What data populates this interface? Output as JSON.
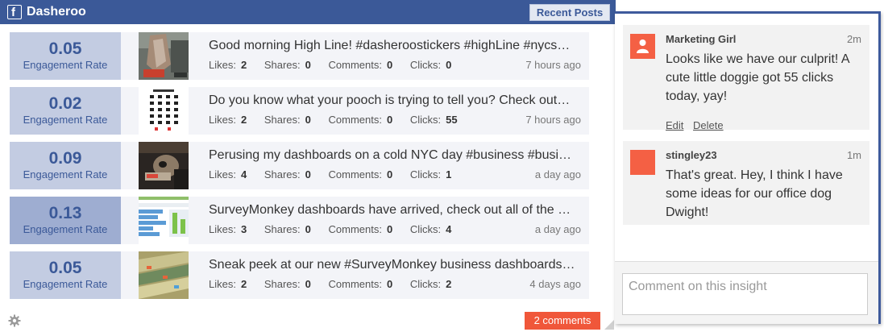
{
  "widget": {
    "title": "Dasheroo",
    "recent_posts_label": "Recent Posts",
    "comments_button": "2 comments"
  },
  "posts": [
    {
      "metric_value": "0.05",
      "metric_label": "Engagement Rate",
      "title": "Good morning High Line! #dasheroostickers #highLine #nycs…",
      "likes_label": "Likes:",
      "likes": "2",
      "shares_label": "Shares:",
      "shares": "0",
      "comments_label": "Comments:",
      "comments": "0",
      "clicks_label": "Clicks:",
      "clicks": "0",
      "time": "7 hours ago"
    },
    {
      "metric_value": "0.02",
      "metric_label": "Engagement Rate",
      "title": "Do you know what your pooch is trying to tell you? Check out…",
      "likes_label": "Likes:",
      "likes": "2",
      "shares_label": "Shares:",
      "shares": "0",
      "comments_label": "Comments:",
      "comments": "0",
      "clicks_label": "Clicks:",
      "clicks": "55",
      "time": "7 hours ago"
    },
    {
      "metric_value": "0.09",
      "metric_label": "Engagement Rate",
      "title": "Perusing my dashboards on a cold NYC day #business #busi…",
      "likes_label": "Likes:",
      "likes": "4",
      "shares_label": "Shares:",
      "shares": "0",
      "comments_label": "Comments:",
      "comments": "0",
      "clicks_label": "Clicks:",
      "clicks": "1",
      "time": "a day ago"
    },
    {
      "metric_value": "0.13",
      "metric_label": "Engagement Rate",
      "title": "SurveyMonkey dashboards have arrived, check out all of the …",
      "likes_label": "Likes:",
      "likes": "3",
      "shares_label": "Shares:",
      "shares": "0",
      "comments_label": "Comments:",
      "comments": "0",
      "clicks_label": "Clicks:",
      "clicks": "4",
      "time": "a day ago"
    },
    {
      "metric_value": "0.05",
      "metric_label": "Engagement Rate",
      "title": "Sneak peek at our new #SurveyMonkey business dashboards…",
      "likes_label": "Likes:",
      "likes": "2",
      "shares_label": "Shares:",
      "shares": "0",
      "comments_label": "Comments:",
      "comments": "0",
      "clicks_label": "Clicks:",
      "clicks": "2",
      "time": "4 days ago"
    }
  ],
  "comments_panel": {
    "comments": [
      {
        "author": "Marketing Girl",
        "time": "2m",
        "text": "Looks like we have our culprit! A cute little doggie got 55 clicks today, yay!",
        "edit_label": "Edit",
        "delete_label": "Delete"
      },
      {
        "author": "stingley23",
        "time": "1m",
        "text": "That's great. Hey, I think I have some ideas for our office dog Dwight!"
      }
    ],
    "input_placeholder": "Comment on this insight"
  },
  "colors": {
    "facebook_blue": "#3b5998",
    "metric_bg": "#c3cce2",
    "metric_highlight_bg": "#9eadd1",
    "accent_orange": "#f0573a"
  },
  "icons": {
    "facebook": "facebook-icon",
    "gear": "gear-icon",
    "avatar": "user-avatar-icon",
    "resize": "resize-grip-icon"
  }
}
